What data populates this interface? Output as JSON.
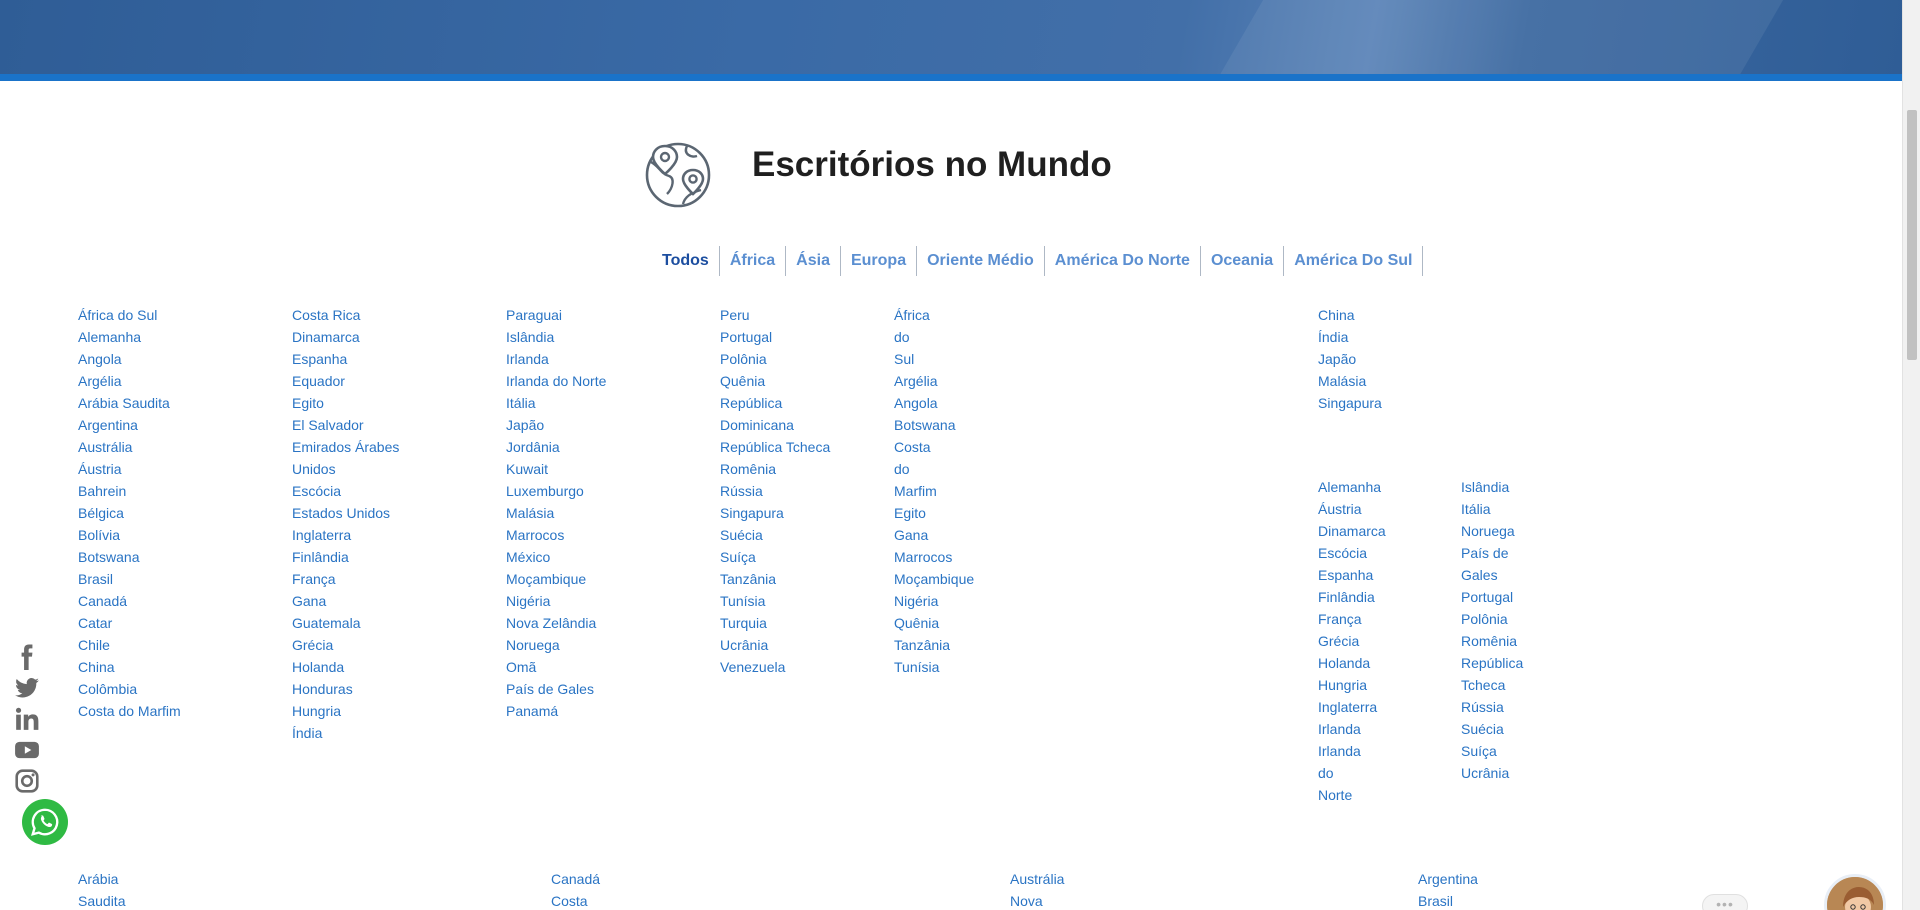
{
  "section": {
    "title": "Escritórios no Mundo"
  },
  "tabs": [
    {
      "label": "Todos"
    },
    {
      "label": "África"
    },
    {
      "label": "Ásia"
    },
    {
      "label": "Europa"
    },
    {
      "label": "Oriente Médio"
    },
    {
      "label": "América Do Norte"
    },
    {
      "label": "Oceania"
    },
    {
      "label": "América Do Sul"
    }
  ],
  "columns": {
    "todos_1": [
      "África do Sul",
      "Alemanha",
      "Angola",
      "Argélia",
      "Arábia Saudita",
      "Argentina",
      "Austrália",
      "Áustria",
      "Bahrein",
      "Bélgica",
      "Bolívia",
      "Botswana",
      "Brasil",
      "Canadá",
      "Catar",
      "Chile",
      "China",
      "Colômbia",
      "Costa do Marfim"
    ],
    "todos_2": [
      "Costa Rica",
      "Dinamarca",
      "Espanha",
      "Equador",
      "Egito",
      "El Salvador",
      "Emirados Árabes",
      "Unidos",
      "Escócia",
      "Estados Unidos",
      "Inglaterra",
      "Finlândia",
      "França",
      "Gana",
      "Guatemala",
      "Grécia",
      "Holanda",
      "Honduras",
      "Hungria",
      "Índia"
    ],
    "todos_3": [
      "Paraguai",
      "Islândia",
      "Irlanda",
      "Irlanda do Norte",
      "Itália",
      "Japão",
      "Jordânia",
      "Kuwait",
      "Luxemburgo",
      "Malásia",
      "Marrocos",
      "México",
      "Moçambique",
      "Nigéria",
      "Nova Zelândia",
      "Noruega",
      "Omã",
      "País de Gales",
      "Panamá"
    ],
    "todos_4": [
      "Peru",
      "Portugal",
      "Polônia",
      "Quênia",
      "República",
      "Dominicana",
      "República Tcheca",
      "Romênia",
      "Rússia",
      "Singapura",
      "Suécia",
      "Suíça",
      "Tanzânia",
      "Tunísia",
      "Turquia",
      "Ucrânia",
      "Venezuela"
    ],
    "africa": [
      "África",
      "do",
      "Sul",
      "Argélia",
      "Angola",
      "Botswana",
      "Costa",
      "do",
      "Marfim",
      "Egito",
      "Gana",
      "Marrocos",
      "Moçambique",
      "Nigéria",
      "Quênia",
      "Tanzânia",
      "Tunísia"
    ],
    "asia": [
      "China",
      "Índia",
      "Japão",
      "Malásia",
      "Singapura"
    ],
    "europa_1": [
      "Alemanha",
      "Áustria",
      "Dinamarca",
      "Escócia",
      "Espanha",
      "Finlândia",
      "França",
      "Grécia",
      "Holanda",
      "Hungria",
      "Inglaterra",
      "Irlanda",
      "Irlanda",
      "do",
      "Norte"
    ],
    "europa_2": [
      "Islândia",
      "Itália",
      "Noruega",
      "País de",
      "Gales",
      "Portugal",
      "Polônia",
      "Romênia",
      "República",
      "Tcheca",
      "Rússia",
      "Suécia",
      "Suíça",
      "Ucrânia"
    ],
    "bottom_1": [
      "Arábia",
      "Saudita"
    ],
    "bottom_2": [
      "Canadá",
      "Costa"
    ],
    "bottom_3": [
      "Austrália",
      "Nova"
    ],
    "bottom_4": [
      "Argentina",
      "Brasil"
    ]
  },
  "social": {
    "icons": [
      "facebook-icon",
      "twitter-icon",
      "linkedin-icon",
      "youtube-icon",
      "instagram-icon",
      "whatsapp-icon"
    ]
  },
  "chat": {
    "bubble_text": "•••"
  },
  "colors": {
    "link": "#2a74c4",
    "tab": "#5b8fd1",
    "tab_active": "#1c4ea0",
    "hero": "#2f5d96",
    "hero_line": "#1a73c9",
    "whatsapp": "#2fba43"
  }
}
